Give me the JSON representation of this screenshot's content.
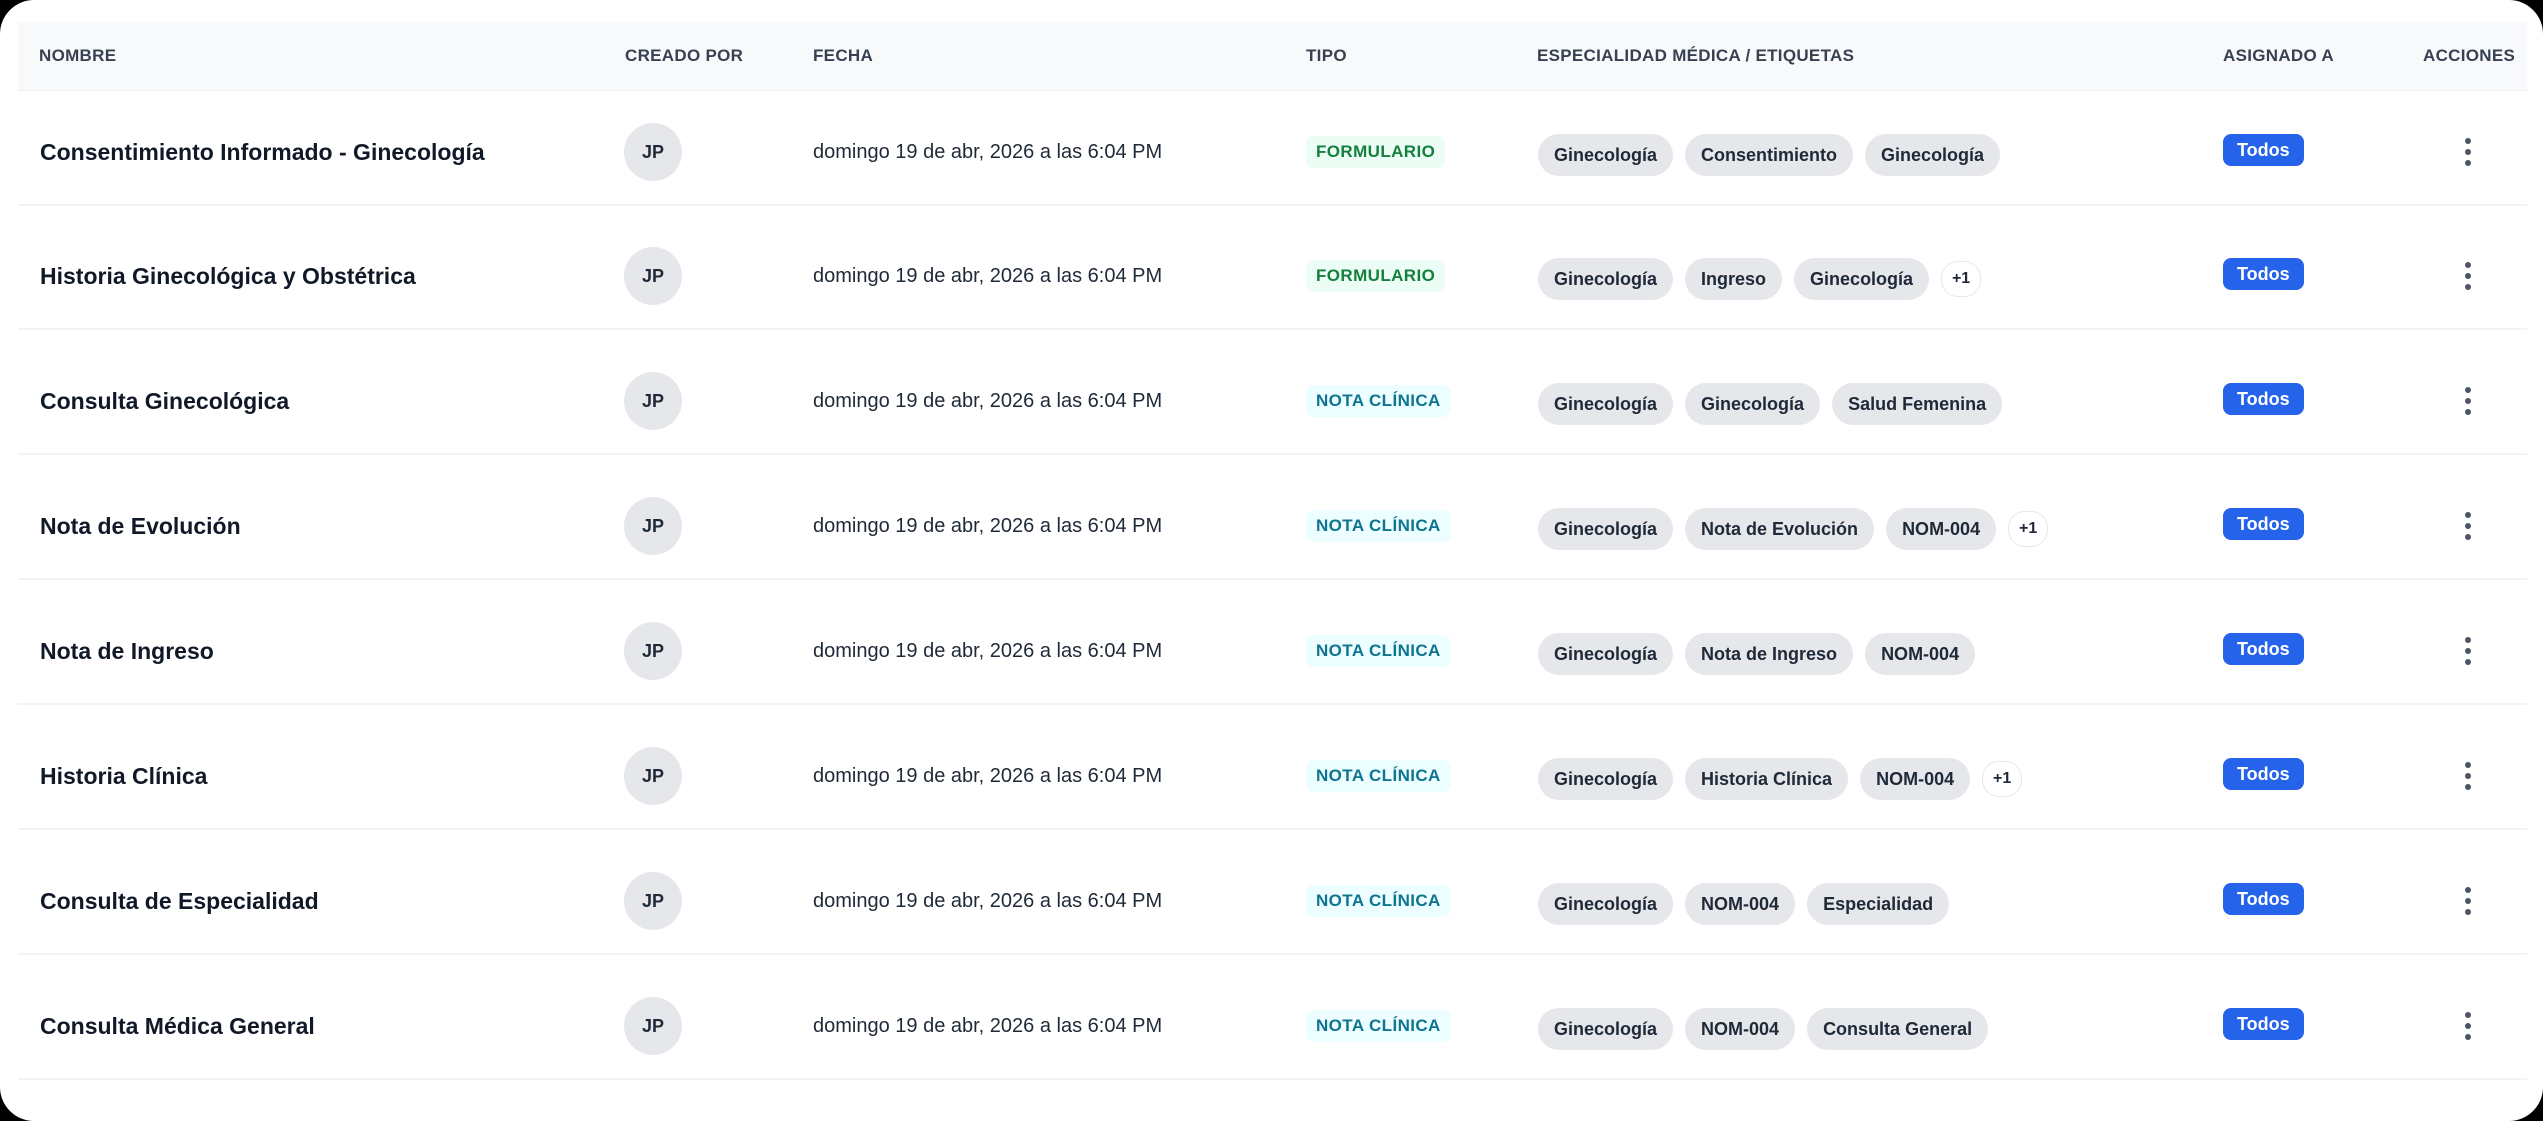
{
  "columns": {
    "name": "NOMBRE",
    "created_by": "CREADO POR",
    "date": "FECHA",
    "type": "TIPO",
    "tags": "ESPECIALIDAD MÉDICA / ETIQUETAS",
    "assigned": "ASIGNADO A",
    "actions": "ACCIONES"
  },
  "rows": [
    {
      "name": "Consentimiento Informado - Ginecología",
      "created_by": "JP",
      "date": "domingo 19 de abr, 2026 a las 6:04 PM",
      "type": "FORMULARIO",
      "type_kind": "form",
      "tags": [
        "Ginecología",
        "Consentimiento",
        "Ginecología"
      ],
      "more": "",
      "assigned": "Todos",
      "actions_icon": "more-vertical-icon"
    },
    {
      "name": "Historia Ginecológica y Obstétrica",
      "created_by": "JP",
      "date": "domingo 19 de abr, 2026 a las 6:04 PM",
      "type": "FORMULARIO",
      "type_kind": "form",
      "tags": [
        "Ginecología",
        "Ingreso",
        "Ginecología"
      ],
      "more": "+1",
      "assigned": "Todos",
      "actions_icon": "more-vertical-icon"
    },
    {
      "name": "Consulta Ginecológica",
      "created_by": "JP",
      "date": "domingo 19 de abr, 2026 a las 6:04 PM",
      "type": "NOTA CLÍNICA",
      "type_kind": "nota",
      "tags": [
        "Ginecología",
        "Ginecología",
        "Salud Femenina"
      ],
      "more": "",
      "assigned": "Todos",
      "actions_icon": "more-vertical-icon"
    },
    {
      "name": "Nota de Evolución",
      "created_by": "JP",
      "date": "domingo 19 de abr, 2026 a las 6:04 PM",
      "type": "NOTA CLÍNICA",
      "type_kind": "nota",
      "tags": [
        "Ginecología",
        "Nota de Evolución",
        "NOM-004"
      ],
      "more": "+1",
      "assigned": "Todos",
      "actions_icon": "more-vertical-icon"
    },
    {
      "name": "Nota de Ingreso",
      "created_by": "JP",
      "date": "domingo 19 de abr, 2026 a las 6:04 PM",
      "type": "NOTA CLÍNICA",
      "type_kind": "nota",
      "tags": [
        "Ginecología",
        "Nota de Ingreso",
        "NOM-004"
      ],
      "more": "",
      "assigned": "Todos",
      "actions_icon": "more-vertical-icon"
    },
    {
      "name": "Historia Clínica",
      "created_by": "JP",
      "date": "domingo 19 de abr, 2026 a las 6:04 PM",
      "type": "NOTA CLÍNICA",
      "type_kind": "nota",
      "tags": [
        "Ginecología",
        "Historia Clínica",
        "NOM-004"
      ],
      "more": "+1",
      "assigned": "Todos",
      "actions_icon": "more-vertical-icon"
    },
    {
      "name": "Consulta de Especialidad",
      "created_by": "JP",
      "date": "domingo 19 de abr, 2026 a las 6:04 PM",
      "type": "NOTA CLÍNICA",
      "type_kind": "nota",
      "tags": [
        "Ginecología",
        "NOM-004",
        "Especialidad"
      ],
      "more": "",
      "assigned": "Todos",
      "actions_icon": "more-vertical-icon"
    },
    {
      "name": "Consulta Médica General",
      "created_by": "JP",
      "date": "domingo 19 de abr, 2026 a las 6:04 PM",
      "type": "NOTA CLÍNICA",
      "type_kind": "nota",
      "tags": [
        "Ginecología",
        "NOM-004",
        "Consulta General"
      ],
      "more": "",
      "assigned": "Todos",
      "actions_icon": "more-vertical-icon"
    }
  ],
  "colors": {
    "accent_blue": "#2563eb",
    "form_text": "#15803d",
    "nota_text": "#0e7490",
    "tag_bg": "#e5e7eb"
  }
}
